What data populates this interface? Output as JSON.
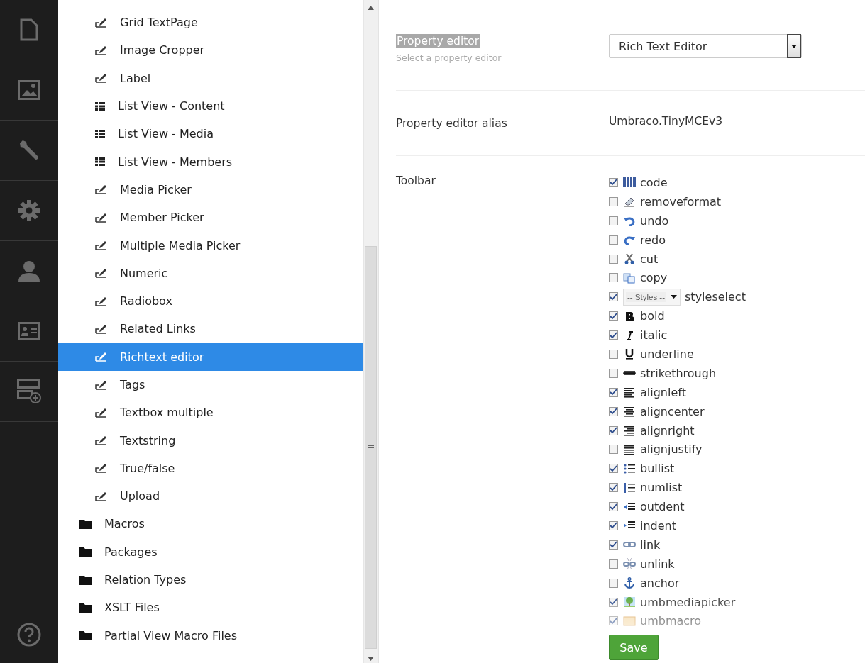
{
  "tree": {
    "items": [
      {
        "label": "Grid TextPage",
        "kind": "editor",
        "selected": false
      },
      {
        "label": "Image Cropper",
        "kind": "editor",
        "selected": false
      },
      {
        "label": "Label",
        "kind": "editor",
        "selected": false
      },
      {
        "label": "List View - Content",
        "kind": "listview",
        "selected": false
      },
      {
        "label": "List View - Media",
        "kind": "listview",
        "selected": false
      },
      {
        "label": "List View - Members",
        "kind": "listview",
        "selected": false
      },
      {
        "label": "Media Picker",
        "kind": "editor",
        "selected": false
      },
      {
        "label": "Member Picker",
        "kind": "editor",
        "selected": false
      },
      {
        "label": "Multiple Media Picker",
        "kind": "editor",
        "selected": false
      },
      {
        "label": "Numeric",
        "kind": "editor",
        "selected": false
      },
      {
        "label": "Radiobox",
        "kind": "editor",
        "selected": false
      },
      {
        "label": "Related Links",
        "kind": "editor",
        "selected": false
      },
      {
        "label": "Richtext editor",
        "kind": "editor",
        "selected": true
      },
      {
        "label": "Tags",
        "kind": "editor",
        "selected": false
      },
      {
        "label": "Textbox multiple",
        "kind": "editor",
        "selected": false
      },
      {
        "label": "Textstring",
        "kind": "editor",
        "selected": false
      },
      {
        "label": "True/false",
        "kind": "editor",
        "selected": false
      },
      {
        "label": "Upload",
        "kind": "editor",
        "selected": false
      },
      {
        "label": "Macros",
        "kind": "folder",
        "selected": false
      },
      {
        "label": "Packages",
        "kind": "folder",
        "selected": false
      },
      {
        "label": "Relation Types",
        "kind": "folder",
        "selected": false
      },
      {
        "label": "XSLT Files",
        "kind": "folder",
        "selected": false
      },
      {
        "label": "Partial View Macro Files",
        "kind": "folder",
        "selected": false
      }
    ]
  },
  "property_editor": {
    "label": "Property editor",
    "description": "Select a property editor",
    "value": "Rich Text Editor"
  },
  "alias": {
    "label": "Property editor alias",
    "value": "Umbraco.TinyMCEv3"
  },
  "toolbar": {
    "label": "Toolbar",
    "items": [
      {
        "label": "code",
        "checked": true,
        "kind": "icon"
      },
      {
        "label": "removeformat",
        "checked": false,
        "kind": "icon"
      },
      {
        "label": "undo",
        "checked": false,
        "kind": "icon"
      },
      {
        "label": "redo",
        "checked": false,
        "kind": "icon"
      },
      {
        "label": "cut",
        "checked": false,
        "kind": "icon"
      },
      {
        "label": "copy",
        "checked": false,
        "kind": "icon"
      },
      {
        "label": "styleselect",
        "checked": true,
        "kind": "dropdown",
        "dropdown_label": "-- Styles --"
      },
      {
        "label": "bold",
        "checked": true,
        "kind": "icon"
      },
      {
        "label": "italic",
        "checked": true,
        "kind": "icon"
      },
      {
        "label": "underline",
        "checked": false,
        "kind": "icon"
      },
      {
        "label": "strikethrough",
        "checked": false,
        "kind": "icon"
      },
      {
        "label": "alignleft",
        "checked": true,
        "kind": "icon"
      },
      {
        "label": "aligncenter",
        "checked": true,
        "kind": "icon"
      },
      {
        "label": "alignright",
        "checked": true,
        "kind": "icon"
      },
      {
        "label": "alignjustify",
        "checked": false,
        "kind": "icon"
      },
      {
        "label": "bullist",
        "checked": true,
        "kind": "icon"
      },
      {
        "label": "numlist",
        "checked": true,
        "kind": "icon"
      },
      {
        "label": "outdent",
        "checked": true,
        "kind": "icon"
      },
      {
        "label": "indent",
        "checked": true,
        "kind": "icon"
      },
      {
        "label": "link",
        "checked": true,
        "kind": "icon"
      },
      {
        "label": "unlink",
        "checked": false,
        "kind": "icon"
      },
      {
        "label": "anchor",
        "checked": false,
        "kind": "icon"
      },
      {
        "label": "umbmediapicker",
        "checked": true,
        "kind": "icon"
      },
      {
        "label": "umbmacro",
        "checked": true,
        "kind": "icon"
      }
    ]
  },
  "save_button": "Save"
}
